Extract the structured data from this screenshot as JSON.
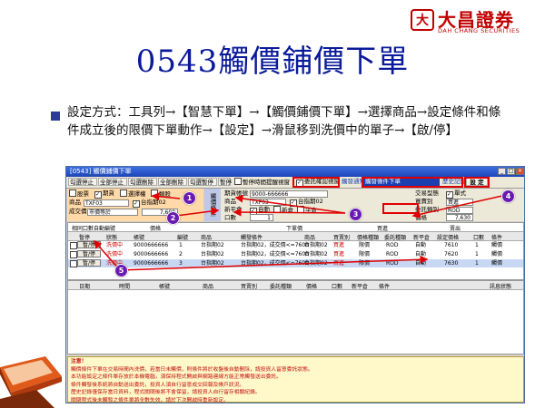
{
  "logo": {
    "mark": "大",
    "name": "大昌證券",
    "english": "DAH CHANG SECURITIES"
  },
  "slide": {
    "title": "0543觸價鋪價下單",
    "description": "設定方式：工具列→【智慧下單】→【觸價鋪價下單】→選擇商品→設定條件和條件成立後的限價下單動作→【設定】→滑鼠移到洗價中的單子→【啟/停】"
  },
  "app": {
    "title": "[0543] 觸價鋪價下單",
    "toolbar": [
      "勾選停止",
      "全部停止",
      "勾選刪除",
      "全部刪除",
      "勾選暫停",
      "暫停"
    ],
    "toolbar_checkbox": "暫停時間提醒視窗",
    "confirm_checkbox": "委託確認視窗",
    "links": [
      "觸發通知",
      "歷史記錄"
    ],
    "type_select": "觸發條件下單",
    "set_button": "設 定",
    "left_panel": {
      "radios": [
        "股票",
        "期貨",
        "選擇權",
        "類股"
      ],
      "product_label": "商品",
      "product_value": "TXF03",
      "product_tag": "台指期02",
      "deal_label": "成交價",
      "deal_value": "7,600",
      "deal_mode": "市價等於"
    },
    "condition": {
      "section_label": "觸價條件",
      "account_label": "期貨帳號",
      "account_value": "9000-666666",
      "product_label": "商品",
      "product_value": "TXF03",
      "product_tag": "台指期02",
      "new_close_label": "新平倉",
      "new_close_options": [
        "自動",
        "新倉",
        "平倉"
      ],
      "order_type_label": "單別",
      "qty_label": "口數",
      "qty_value": "1",
      "trade_type_label": "交易型態",
      "trade_type_value": "單式",
      "side_label": "買賣別",
      "side_value": "買進",
      "order_kind_label": "委託類別",
      "order_kind_value": "ROD",
      "price_label": "價格",
      "price_value": "7,630"
    },
    "grid_filter": [
      "相同口數自動編號",
      "價格",
      "下單價",
      "買進",
      "賣出"
    ],
    "columns": [
      "暫停",
      "狀態",
      "帳號",
      "編號",
      "商品",
      "觸發條件",
      "商品",
      "買賣別",
      "價格種類",
      "委託種類",
      "新平倉",
      "設定價格",
      "口數",
      "條件"
    ],
    "rows": [
      {
        "btn": "暫/停",
        "status": "洗價中",
        "account": "9000666666",
        "no": "1",
        "product": "台指期02",
        "condition": "台指期02，成交價<=7600",
        "product2": "台指期02",
        "side": "買進",
        "ptype": "限價",
        "otype": "ROD",
        "new": "自動",
        "price": "7610",
        "qty": "1",
        "cond": "觸價"
      },
      {
        "btn": "暫/停",
        "status": "洗價中",
        "account": "9000666666",
        "no": "2",
        "product": "台指期02",
        "condition": "台指期02，成交價<=7600",
        "product2": "台指期02",
        "side": "買進",
        "ptype": "限價",
        "otype": "ROD",
        "new": "自動",
        "price": "7620",
        "qty": "1",
        "cond": "觸價"
      },
      {
        "btn": "暫/停",
        "status": "洗價中",
        "account": "9000666666",
        "no": "3",
        "product": "台指期02",
        "condition": "台指期02，成交價<=7600",
        "product2": "台指期02",
        "side": "買進",
        "ptype": "限價",
        "otype": "ROD",
        "new": "自動",
        "price": "7630",
        "qty": "1",
        "cond": "觸價"
      }
    ],
    "history_columns": [
      "日期",
      "時間",
      "帳號",
      "商品",
      "買賣別",
      "委託種類",
      "價格",
      "口數",
      "新平倉",
      "條件",
      "訊息狀態"
    ],
    "notice_title": "注意！",
    "notice_lines": [
      "觸價條件下單在交易時間內洗價，若當日未觸價，則條件將於收盤後自動刪除，請投資人留意委託狀態。",
      "本功能設定之條件單存放於本機電腦，須保持程式開啟與網路連線方能正常觸發送出委託。",
      "條件觸發後系統將自動送出委託，投資人須自行留意成交回報及帳戶狀況。",
      "歷史記錄僅保存當日資料，程式關閉後將不會保留，請投資人自行留存相關紀錄。",
      "關閉程式後未觸發之條件單將全數失效，請於下次開啟時重新設定。"
    ]
  },
  "callouts": [
    "1",
    "2",
    "3",
    "4",
    "5"
  ],
  "colors": {
    "title": "#0a1a9a",
    "brand": "#c00000",
    "callout": "#6a1ab0",
    "highlight": "#e00000"
  }
}
